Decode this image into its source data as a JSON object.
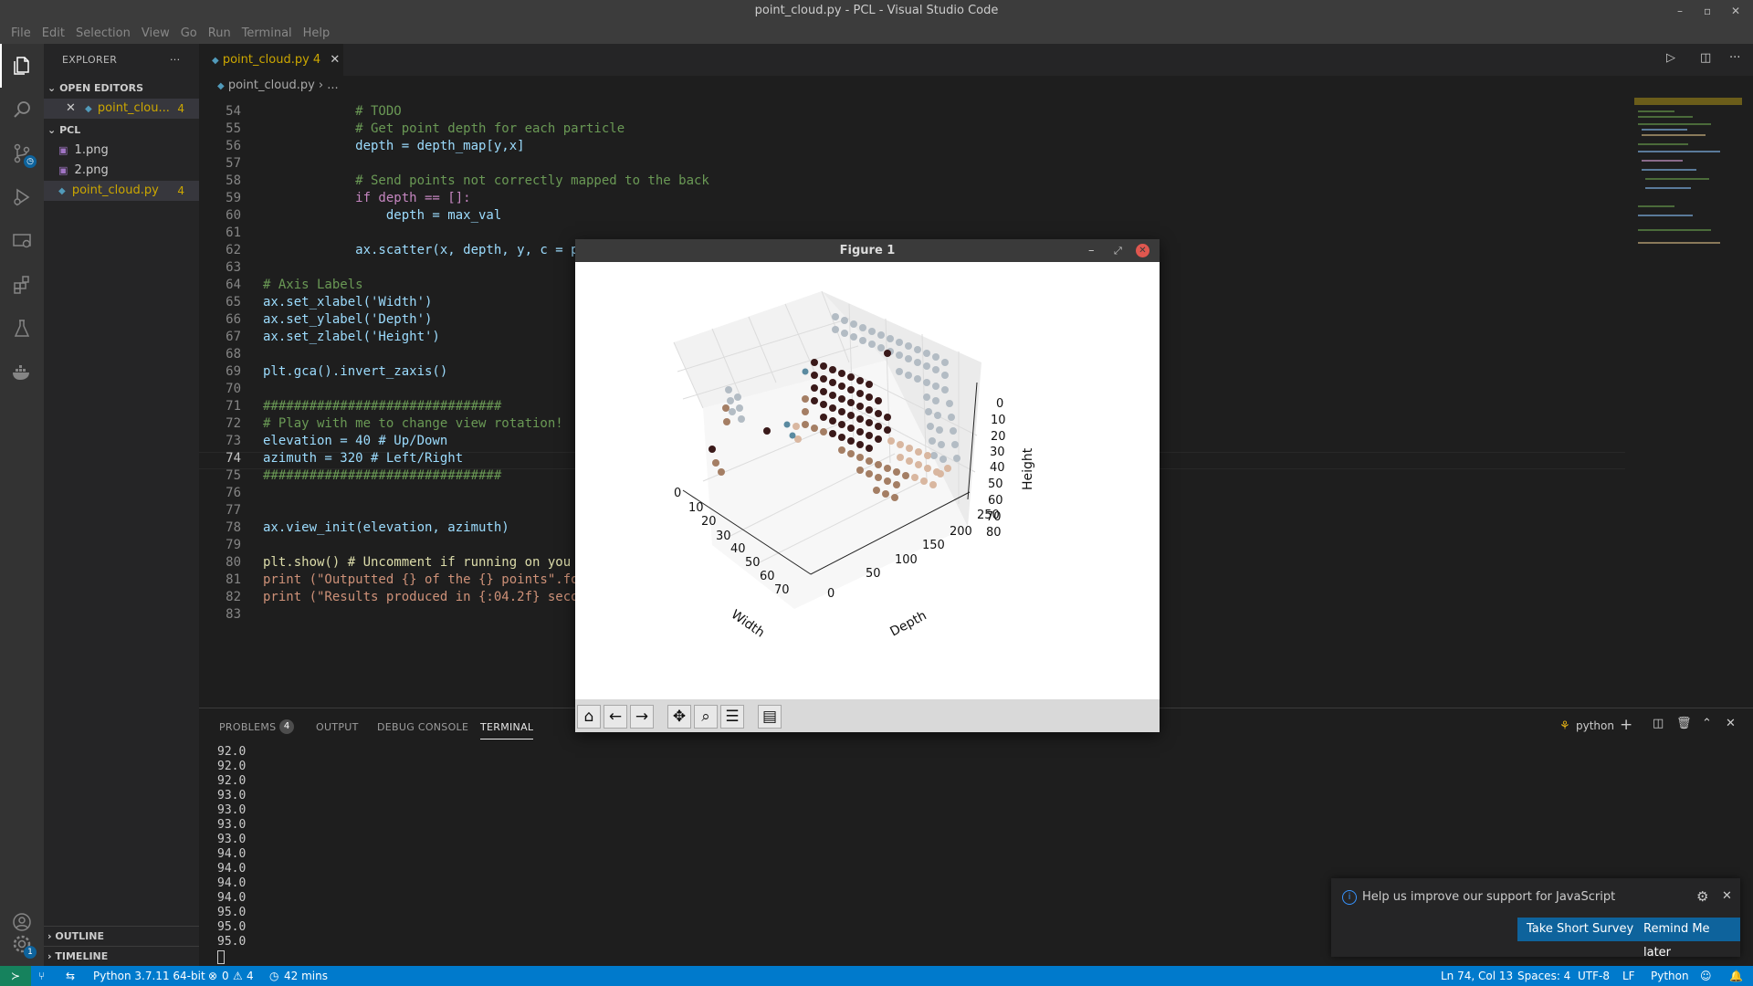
{
  "window": {
    "title": "point_cloud.py - PCL - Visual Studio Code"
  },
  "menu": [
    "File",
    "Edit",
    "Selection",
    "View",
    "Go",
    "Run",
    "Terminal",
    "Help"
  ],
  "sidebar": {
    "title": "EXPLORER",
    "open_editors_label": "OPEN EDITORS",
    "open_editor_file": "point_clou...",
    "open_editor_count": "4",
    "project_label": "PCL",
    "files": [
      {
        "name": "1.png",
        "count": ""
      },
      {
        "name": "2.png",
        "count": ""
      },
      {
        "name": "point_cloud.py",
        "count": "4"
      }
    ],
    "outline_label": "OUTLINE",
    "timeline_label": "TIMELINE"
  },
  "tab": {
    "name": "point_cloud.py",
    "count": "4"
  },
  "breadcrumb": {
    "file": "point_cloud.py",
    "more": "..."
  },
  "editor": {
    "lines": [
      {
        "n": "54",
        "t": "            # TODO"
      },
      {
        "n": "55",
        "t": "            # Get point depth for each particle"
      },
      {
        "n": "56",
        "t": "            depth = depth_map[y,x]"
      },
      {
        "n": "57",
        "t": ""
      },
      {
        "n": "58",
        "t": "            # Send points not correctly mapped to the back"
      },
      {
        "n": "59",
        "t": "            if depth == []:"
      },
      {
        "n": "60",
        "t": "                depth = max_val"
      },
      {
        "n": "61",
        "t": ""
      },
      {
        "n": "62",
        "t": "            ax.scatter(x, depth, y, c = p"
      },
      {
        "n": "63",
        "t": ""
      },
      {
        "n": "64",
        "t": "# Axis Labels"
      },
      {
        "n": "65",
        "t": "ax.set_xlabel('Width')"
      },
      {
        "n": "66",
        "t": "ax.set_ylabel('Depth')"
      },
      {
        "n": "67",
        "t": "ax.set_zlabel('Height')"
      },
      {
        "n": "68",
        "t": ""
      },
      {
        "n": "69",
        "t": "plt.gca().invert_zaxis()"
      },
      {
        "n": "70",
        "t": ""
      },
      {
        "n": "71",
        "t": "###############################"
      },
      {
        "n": "72",
        "t": "# Play with me to change view rotation!"
      },
      {
        "n": "73",
        "t": "elevation = 40 # Up/Down"
      },
      {
        "n": "74",
        "t": "azimuth = 320 # Left/Right"
      },
      {
        "n": "75",
        "t": "###############################"
      },
      {
        "n": "76",
        "t": ""
      },
      {
        "n": "77",
        "t": ""
      },
      {
        "n": "78",
        "t": "ax.view_init(elevation, azimuth)"
      },
      {
        "n": "79",
        "t": ""
      },
      {
        "n": "80",
        "t": "plt.show() # Uncomment if running on you"
      },
      {
        "n": "81",
        "t": "print (\"Outputted {} of the {} points\".fo"
      },
      {
        "n": "82",
        "t": "print (\"Results produced in {:04.2f} seco"
      },
      {
        "n": "83",
        "t": ""
      }
    ]
  },
  "panel": {
    "tabs": [
      "PROBLEMS",
      "OUTPUT",
      "DEBUG CONSOLE",
      "TERMINAL"
    ],
    "problems_count": "4",
    "shell": "python",
    "terminal_lines": [
      "92.0",
      "92.0",
      "92.0",
      "93.0",
      "93.0",
      "93.0",
      "93.0",
      "94.0",
      "94.0",
      "94.0",
      "94.0",
      "95.0",
      "95.0",
      "95.0"
    ]
  },
  "figure": {
    "title": "Figure 1",
    "toolbar": [
      "home-icon",
      "back-arrow-icon",
      "forward-arrow-icon",
      "pan-icon",
      "zoom-icon",
      "configure-icon",
      "save-icon"
    ],
    "chart_data": {
      "type": "scatter",
      "projection": "3d",
      "xlabel": "Width",
      "ylabel": "Depth",
      "zlabel": "Height",
      "xticks": [
        "0",
        "10",
        "20",
        "30",
        "40",
        "50",
        "60",
        "70"
      ],
      "yticks": [
        "0",
        "50",
        "100",
        "150",
        "200",
        "250"
      ],
      "zticks": [
        "0",
        "10",
        "20",
        "30",
        "40",
        "50",
        "60",
        "70",
        "80"
      ],
      "zaxis_inverted": true,
      "elevation": 40,
      "azimuth": 320
    }
  },
  "notification": {
    "message": "Help us improve our support for JavaScript",
    "primary": "Take Short Survey",
    "secondary": "Remind Me later"
  },
  "status": {
    "python": "Python 3.7.11 64-bit",
    "errors": "0",
    "warnings": "4",
    "time": "42 mins",
    "position": "Ln 74, Col 13",
    "spaces": "Spaces: 4",
    "encoding": "UTF-8",
    "eol": "LF",
    "language": "Python"
  },
  "colors": {
    "accent": "#007acc",
    "warning": "#cca700",
    "button": "#0e639c"
  }
}
